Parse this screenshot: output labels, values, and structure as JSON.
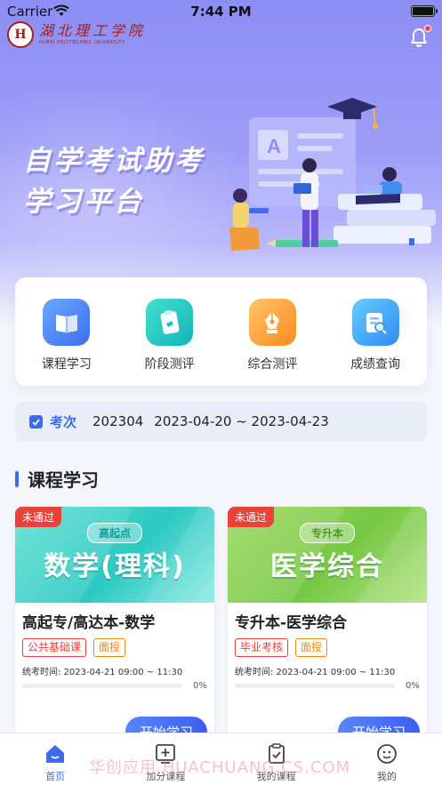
{
  "status_bar": {
    "carrier": "Carrier",
    "time": "7:44 PM"
  },
  "header": {
    "logo_seal": "H",
    "logo_cn": "湖北理工学院",
    "logo_en": "HUBEI POLYTECHNIC UNIVERSITY",
    "notification_icon": "bell-icon"
  },
  "hero": {
    "line1": "自学考试助考",
    "line2": "学习平台"
  },
  "menu": [
    {
      "label": "课程学习",
      "icon": "book-icon",
      "color": "#3d6cf2"
    },
    {
      "label": "阶段测评",
      "icon": "clipboard-icon",
      "color": "#14b4b7"
    },
    {
      "label": "综合测评",
      "icon": "pen-nib-icon",
      "color": "#ff8b1c"
    },
    {
      "label": "成绩查询",
      "icon": "report-icon",
      "color": "#2f8bf3"
    }
  ],
  "exam": {
    "label": "考次",
    "term": "202304",
    "range": "2023-04-20 ~ 2023-04-23"
  },
  "section": {
    "title": "课程学习"
  },
  "courses": [
    {
      "status": "未通过",
      "banner_tag": "高起点",
      "banner_title": "数学(理科)",
      "name": "高起专/高达本-数学",
      "tags": [
        "公共基础课",
        "面授"
      ],
      "exam_time": "统考时间:  2023-04-21  09:00 ~ 11:30",
      "progress": "0%",
      "button": "开始学习"
    },
    {
      "status": "未通过",
      "banner_tag": "专升本",
      "banner_title": "医学综合",
      "name": "专升本-医学综合",
      "tags": [
        "毕业考核",
        "面授"
      ],
      "exam_time": "统考时间:  2023-04-21  09:00 ~ 11:30",
      "progress": "0%",
      "button": "开始学习"
    }
  ],
  "watermark": "华创应用 HUACHUANG.CS.COM",
  "tabs": [
    {
      "label": "首页",
      "icon": "home-icon",
      "active": true
    },
    {
      "label": "加分课程",
      "icon": "add-course-icon",
      "active": false
    },
    {
      "label": "我的课程",
      "icon": "my-course-icon",
      "active": false
    },
    {
      "label": "我的",
      "icon": "profile-icon",
      "active": false
    }
  ],
  "colors": {
    "primary": "#3b6cf0",
    "fail": "#e8423a",
    "accent_orange": "#ef8a17"
  }
}
